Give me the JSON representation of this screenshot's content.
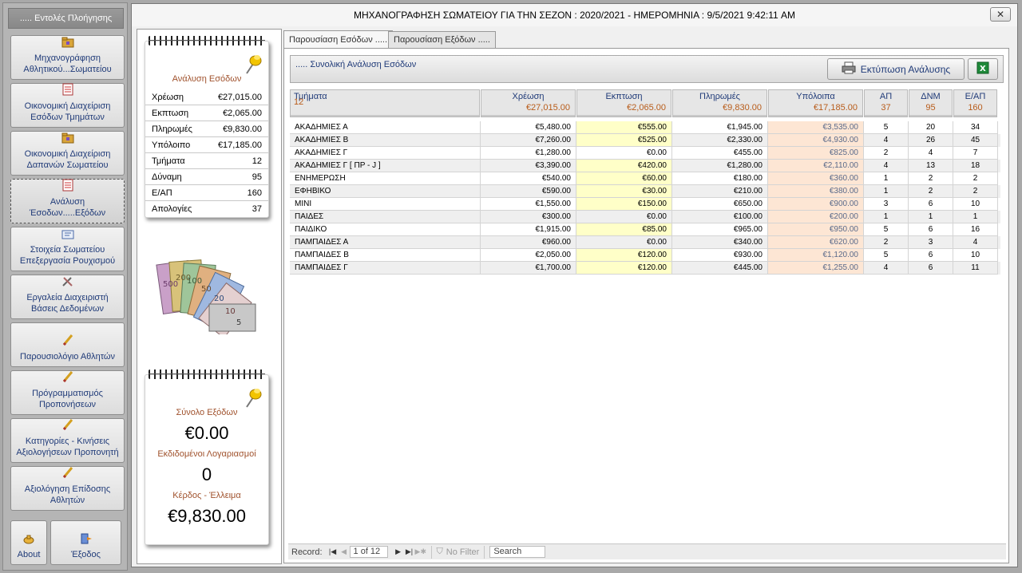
{
  "nav": {
    "title": "..... Εντολές Πλοήγησης",
    "items": [
      {
        "label": "Μηχανογράφηση\nΑθλητικού...Σωματείου",
        "icon": "folder-icon"
      },
      {
        "label": "Οικονομική Διαχείριση\nΕσόδων Τμημάτων",
        "icon": "report-icon"
      },
      {
        "label": "Οικονομική Διαχείριση\nΔαπανών Σωματείου",
        "icon": "folder-icon"
      },
      {
        "label": "Ανάλυση\nΈσοδων.....Εξόδων",
        "icon": "report-icon"
      },
      {
        "label": "Στοιχεία Σωματείου\nΕπεξεργασία Ρουχισμού",
        "icon": "card-icon"
      },
      {
        "label": "Εργαλεία Διαχειριστή\nΒάσεις Δεδομένων",
        "icon": "tools-icon"
      },
      {
        "label": "Παρουσιολόγιο Αθλητών",
        "icon": "pencil-icon"
      },
      {
        "label": "Πρόγραμματισμός\nΠροπονήσεων",
        "icon": "pencil-icon"
      },
      {
        "label": "Κατηγορίες - Κινήσεις\nΑξιολογήσεων Προπονητή",
        "icon": "pencil-icon"
      },
      {
        "label": "Αξιολόγηση Επίδοσης\nΑθλητών",
        "icon": "pencil-icon"
      }
    ],
    "about": "About",
    "exit": "Έξοδος"
  },
  "window": {
    "title": "ΜΗΧΑΝΟΓΡΑΦΗΣΗ ΣΩΜΑΤΕΙΟΥ ΓΙΑ ΤΗΝ ΣΕΖΟΝ : 2020/2021 - ΗΜΕΡΟΜΗΝΙΑ : 9/5/2021 9:42:11 AM",
    "close": "✕"
  },
  "summary": {
    "title": "Ανάλυση Εσόδων",
    "rows": [
      {
        "label": "Χρέωση",
        "value": "€27,015.00"
      },
      {
        "label": "Εκπτωση",
        "value": "€2,065.00"
      },
      {
        "label": "Πληρωμές",
        "value": "€9,830.00"
      },
      {
        "label": "Υπόλοιπο",
        "value": "€17,185.00"
      },
      {
        "label": "Τμήματα",
        "value": "12"
      },
      {
        "label": "Δύναμη",
        "value": "95"
      },
      {
        "label": "Ε/ΑΠ",
        "value": "160"
      },
      {
        "label": "Απολογίες",
        "value": "37"
      }
    ]
  },
  "expenses": {
    "total_label": "Σύνολο Εξόδων",
    "total_value": "€0.00",
    "invoices_label": "Εκδιδομένοι Λογαριασμοί",
    "invoices_value": "0",
    "profit_label": "Κέρδος - Έλλειμα",
    "profit_value": "€9,830.00"
  },
  "tabs": [
    {
      "label": "Παρουσίαση Εσόδων .....",
      "active": true
    },
    {
      "label": "Παρουσίαση Εξόδων .....",
      "active": false
    }
  ],
  "section": {
    "title": ".....  Συνολική Ανάλυση Εσόδων",
    "print_label": "Εκτύπωση Ανάλυσης"
  },
  "grid": {
    "columns": [
      {
        "label": "Τμήματα",
        "total": "12"
      },
      {
        "label": "Χρέωση",
        "total": "€27,015.00"
      },
      {
        "label": "Εκπτωση",
        "total": "€2,065.00"
      },
      {
        "label": "Πληρωμές",
        "total": "€9,830.00"
      },
      {
        "label": "Υπόλοιπα",
        "total": "€17,185.00"
      },
      {
        "label": "ΑΠ",
        "total": "37"
      },
      {
        "label": "ΔΝΜ",
        "total": "95"
      },
      {
        "label": "Ε/ΑΠ",
        "total": "160"
      }
    ],
    "rows": [
      [
        "ΑΚΑΔΗΜΙΕΣ Α",
        "€5,480.00",
        "€555.00",
        "€1,945.00",
        "€3,535.00",
        "5",
        "20",
        "34"
      ],
      [
        "ΑΚΑΔΗΜΙΕΣ Β",
        "€7,260.00",
        "€525.00",
        "€2,330.00",
        "€4,930.00",
        "4",
        "26",
        "45"
      ],
      [
        "ΑΚΑΔΗΜΙΕΣ Γ",
        "€1,280.00",
        "€0.00",
        "€455.00",
        "€825.00",
        "2",
        "4",
        "7"
      ],
      [
        "ΑΚΑΔΗΜΙΕΣ Γ [ ΠΡ - J ]",
        "€3,390.00",
        "€420.00",
        "€1,280.00",
        "€2,110.00",
        "4",
        "13",
        "18"
      ],
      [
        "ΕΝΗΜΕΡΩΣΗ",
        "€540.00",
        "€60.00",
        "€180.00",
        "€360.00",
        "1",
        "2",
        "2"
      ],
      [
        "ΕΦΗΒΙΚΟ",
        "€590.00",
        "€30.00",
        "€210.00",
        "€380.00",
        "1",
        "2",
        "2"
      ],
      [
        "ΜΙΝΙ",
        "€1,550.00",
        "€150.00",
        "€650.00",
        "€900.00",
        "3",
        "6",
        "10"
      ],
      [
        "ΠΑΙΔΕΣ",
        "€300.00",
        "€0.00",
        "€100.00",
        "€200.00",
        "1",
        "1",
        "1"
      ],
      [
        "ΠΑΙΔΙΚΟ",
        "€1,915.00",
        "€85.00",
        "€965.00",
        "€950.00",
        "5",
        "6",
        "16"
      ],
      [
        "ΠΑΜΠΑΙΔΕΣ Α",
        "€960.00",
        "€0.00",
        "€340.00",
        "€620.00",
        "2",
        "3",
        "4"
      ],
      [
        "ΠΑΜΠΑΙΔΕΣ Β",
        "€2,050.00",
        "€120.00",
        "€930.00",
        "€1,120.00",
        "5",
        "6",
        "10"
      ],
      [
        "ΠΑΜΠΑΙΔΕΣ Γ",
        "€1,700.00",
        "€120.00",
        "€445.00",
        "€1,255.00",
        "4",
        "6",
        "11"
      ]
    ],
    "discount_highlight": [
      true,
      true,
      false,
      true,
      true,
      true,
      true,
      false,
      true,
      false,
      true,
      true
    ]
  },
  "record_nav": {
    "record_label": "Record:",
    "position": "1 of 12",
    "filter": "No Filter",
    "search_placeholder": "Search"
  },
  "colors": {
    "accent_orange": "#b85c1a",
    "label_blue": "#1f3a78",
    "discount_bg": "#ffffc8",
    "balance_bg": "#fde6d4"
  }
}
